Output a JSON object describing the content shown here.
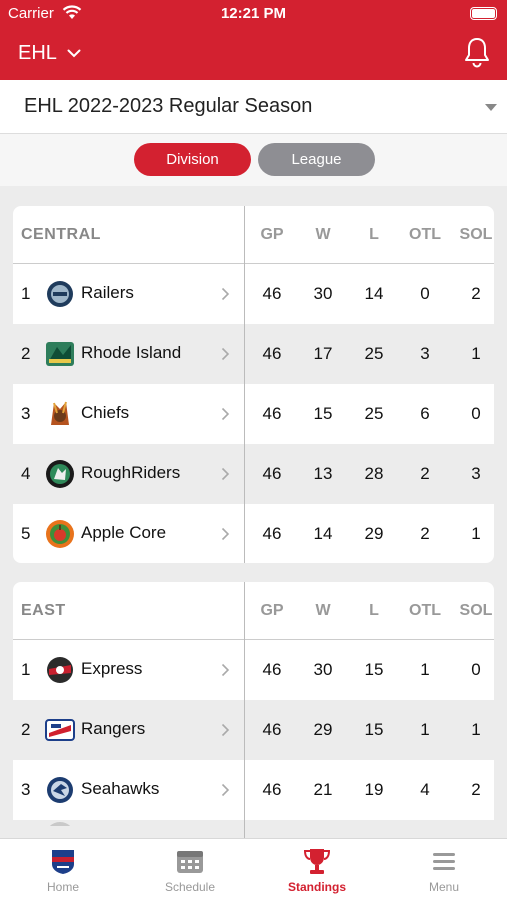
{
  "status_bar": {
    "carrier": "Carrier",
    "time": "12:21 PM"
  },
  "header": {
    "league": "EHL"
  },
  "season": {
    "label": "EHL 2022-2023 Regular Season"
  },
  "segments": {
    "division": "Division",
    "league": "League",
    "active": "Division"
  },
  "columns": [
    "GP",
    "W",
    "L",
    "OTL",
    "SOL"
  ],
  "divisions": [
    {
      "name": "CENTRAL",
      "teams": [
        {
          "rank": "1",
          "name": "Railers",
          "gp": "46",
          "w": "30",
          "l": "14",
          "otl": "0",
          "sol": "2"
        },
        {
          "rank": "2",
          "name": "Rhode Island",
          "gp": "46",
          "w": "17",
          "l": "25",
          "otl": "3",
          "sol": "1"
        },
        {
          "rank": "3",
          "name": "Chiefs",
          "gp": "46",
          "w": "15",
          "l": "25",
          "otl": "6",
          "sol": "0"
        },
        {
          "rank": "4",
          "name": "RoughRiders",
          "gp": "46",
          "w": "13",
          "l": "28",
          "otl": "2",
          "sol": "3"
        },
        {
          "rank": "5",
          "name": "Apple Core",
          "gp": "46",
          "w": "14",
          "l": "29",
          "otl": "2",
          "sol": "1"
        }
      ]
    },
    {
      "name": "EAST",
      "teams": [
        {
          "rank": "1",
          "name": "Express",
          "gp": "46",
          "w": "30",
          "l": "15",
          "otl": "1",
          "sol": "0"
        },
        {
          "rank": "2",
          "name": "Rangers",
          "gp": "46",
          "w": "29",
          "l": "15",
          "otl": "1",
          "sol": "1"
        },
        {
          "rank": "3",
          "name": "Seahawks",
          "gp": "46",
          "w": "21",
          "l": "19",
          "otl": "4",
          "sol": "2"
        }
      ]
    }
  ],
  "tabs": [
    {
      "label": "Home",
      "icon": "home-logo-icon"
    },
    {
      "label": "Schedule",
      "icon": "calendar-icon"
    },
    {
      "label": "Standings",
      "icon": "trophy-icon"
    },
    {
      "label": "Menu",
      "icon": "hamburger-menu-icon"
    }
  ],
  "active_tab": "Standings",
  "colors": {
    "brand": "#d32130",
    "inactive_segment": "#8e8e93",
    "row_alt": "#ececec"
  }
}
